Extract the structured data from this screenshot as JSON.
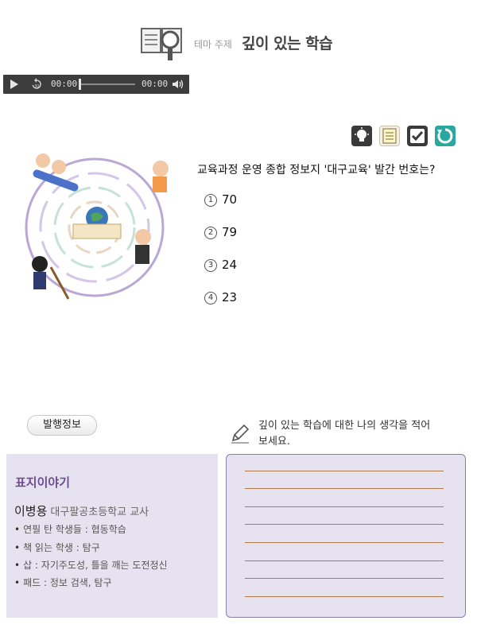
{
  "header": {
    "theme_label": "테마 주제",
    "title": "깊이 있는 학습"
  },
  "audio": {
    "current_time": "00:00",
    "duration": "00:00",
    "progress": 0
  },
  "toolbar": {
    "icons": [
      "lightbulb-icon",
      "note-icon",
      "check-icon",
      "reset-icon"
    ]
  },
  "question": {
    "text": "교육과정 운영 종합 정보지 '대구교육' 발간 번호는?",
    "options": [
      {
        "num": "1",
        "text": "70"
      },
      {
        "num": "2",
        "text": "79"
      },
      {
        "num": "3",
        "text": "24"
      },
      {
        "num": "4",
        "text": "23"
      }
    ]
  },
  "publication_button": "발행정보",
  "prompt": "깊이 있는 학습에 대한 나의 생각을 적어 보세요.",
  "cover_story": {
    "title": "표지이야기",
    "author": "이병용",
    "author_affiliation": "대구팔공초등학교 교사",
    "lines": [
      "연필 탄 학생들 : 협동학습",
      "책 읽는 학생 : 탐구",
      "삽 : 자기주도성, 틀을 깨는 도전정신",
      "패드 : 정보 검색, 탐구"
    ]
  },
  "colors": {
    "accent_purple": "#6e4b96",
    "panel_bg": "#e6e2ef",
    "audio_bg": "#3c3c3c",
    "reset_teal": "#2aa8a0",
    "memo_line": "#b07a4a"
  }
}
